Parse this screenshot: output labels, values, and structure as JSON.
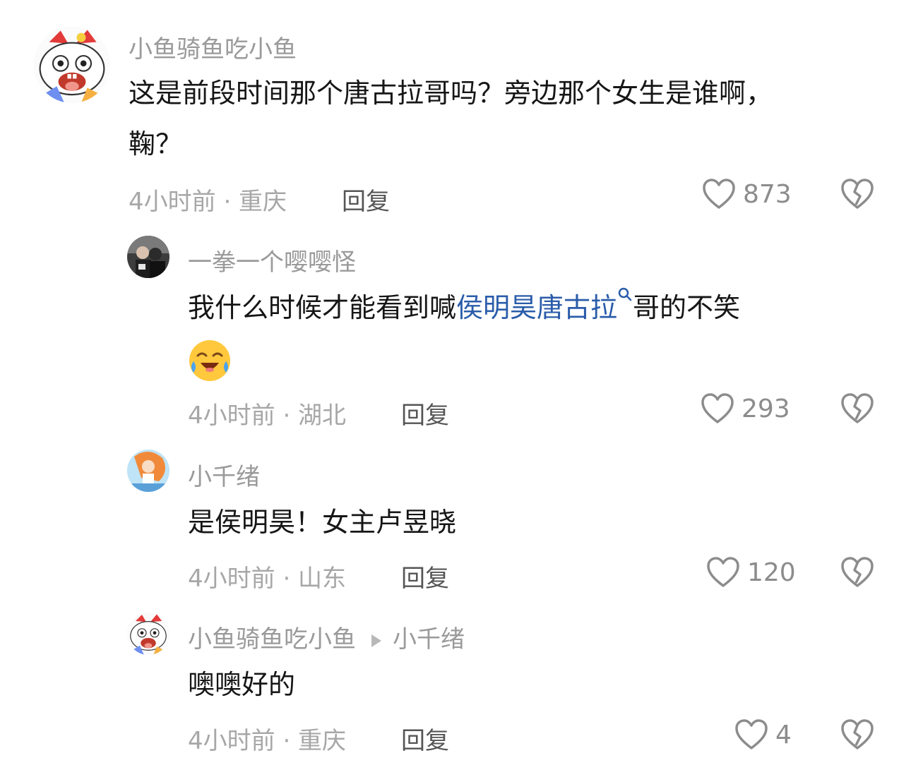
{
  "comments": [
    {
      "user": "小鱼骑鱼吃小鱼",
      "text_line1": "这是前段时间那个唐古拉哥吗？旁边那个女生是谁啊，",
      "text_line2": "鞠？",
      "time": "4小时前 · 重庆",
      "reply": "回复",
      "likes": "873"
    },
    {
      "user": "一拳一个嘤嘤怪",
      "text_before": "我什么时候才能看到喊",
      "text_link": "侯明昊唐古拉",
      "text_after": "哥的不笑",
      "emoji": "crying-laughing-emoji",
      "time": "4小时前 · 湖北",
      "reply": "回复",
      "likes": "293"
    },
    {
      "user": "小千绪",
      "text": "是侯明昊！女主卢昱晓",
      "time": "4小时前 · 山东",
      "reply": "回复",
      "likes": "120"
    },
    {
      "user": "小鱼骑鱼吃小鱼",
      "reply_to": "小千绪",
      "text": "噢噢好的",
      "time": "4小时前 · 重庆",
      "reply": "回复",
      "likes": "4"
    }
  ],
  "icons": {
    "like": "heart-outline-icon",
    "dislike": "broken-heart-icon",
    "search": "search-icon",
    "reply_arrow": "triangle-right-icon"
  },
  "colors": {
    "link": "#2a5caa",
    "username": "#9a9a9a",
    "meta": "#a7a7a7"
  }
}
